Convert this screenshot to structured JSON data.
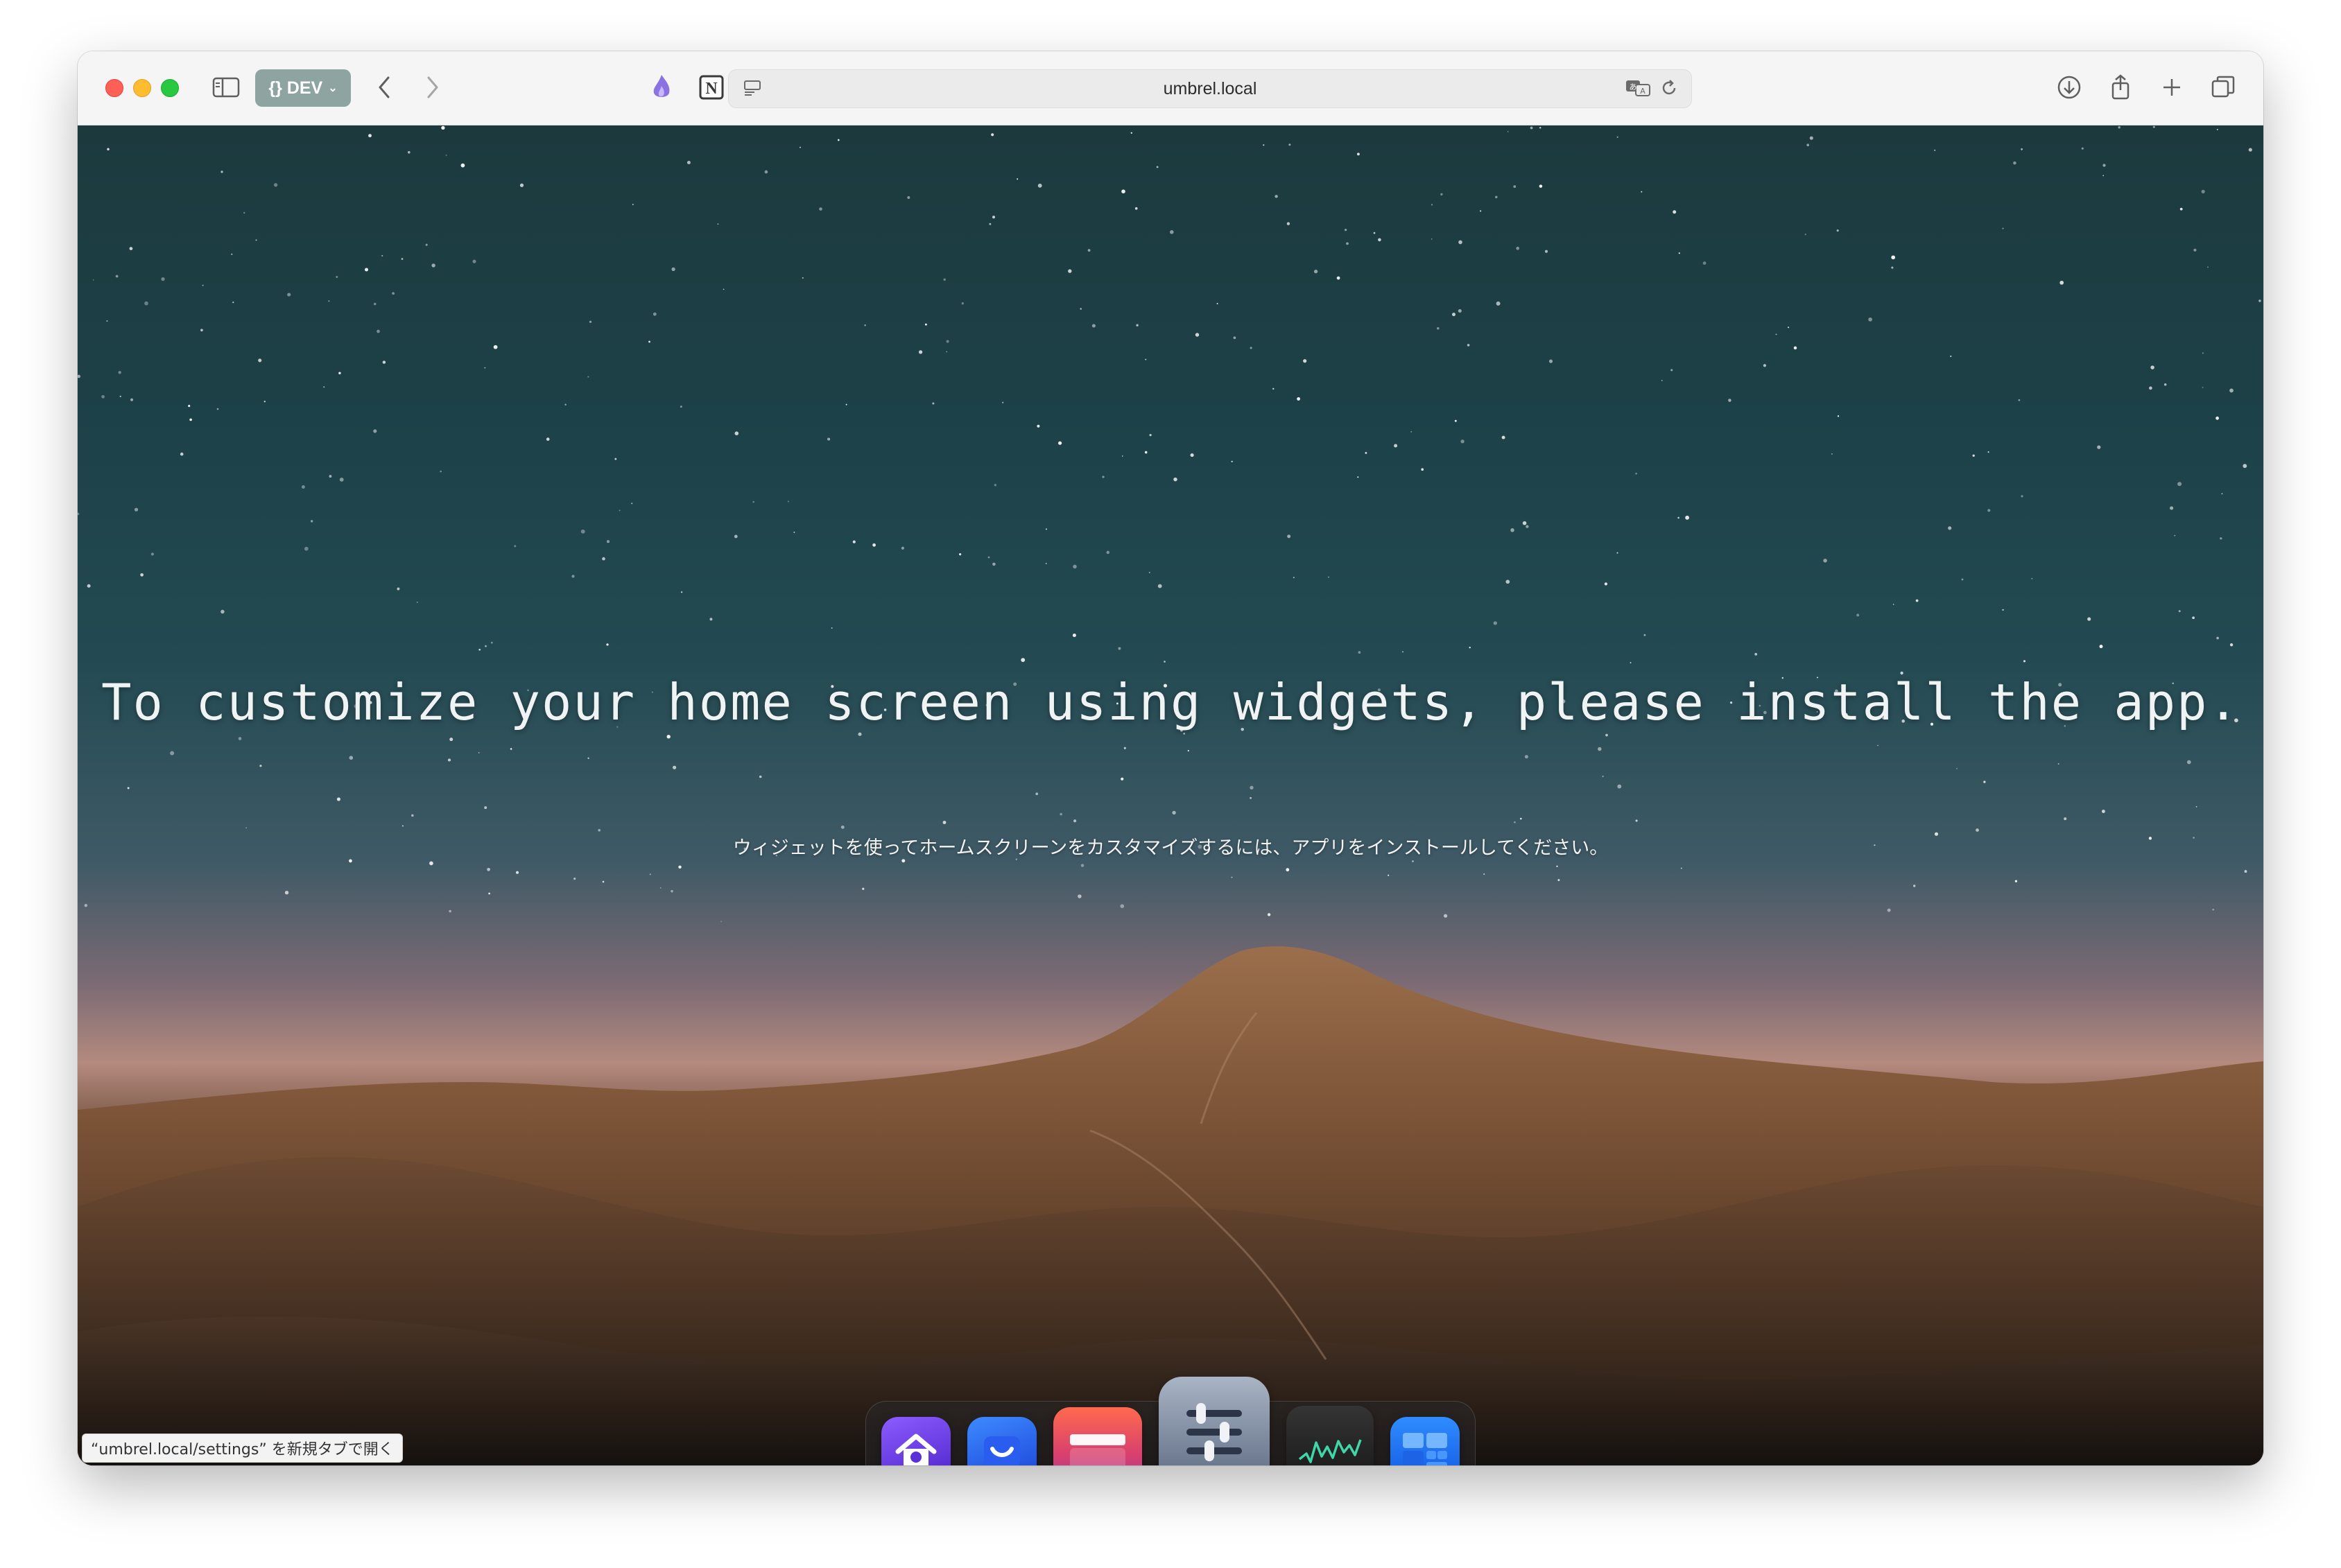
{
  "browser": {
    "dev_badge": "{} DEV",
    "address": "umbrel.local",
    "status_link": "“umbrel.local/settings” を新規タブで開く"
  },
  "page": {
    "headline": "To customize your home screen using widgets, please install the app.",
    "subline": "ウィジェットを使ってホームスクリーンをカスタマイズするには、アプリをインストールしてください。"
  },
  "dock": {
    "apps": [
      {
        "icon": "home-icon"
      },
      {
        "icon": "app-store-icon"
      },
      {
        "icon": "files-icon"
      },
      {
        "icon": "settings-sliders-icon"
      },
      {
        "icon": "live-usage-icon"
      },
      {
        "icon": "widgets-icon"
      }
    ]
  },
  "colors": {
    "traffic_close": "#fe5f57",
    "traffic_minimize": "#febc2e",
    "traffic_maximize": "#28c840",
    "dev_badge": "#8da4a0"
  }
}
